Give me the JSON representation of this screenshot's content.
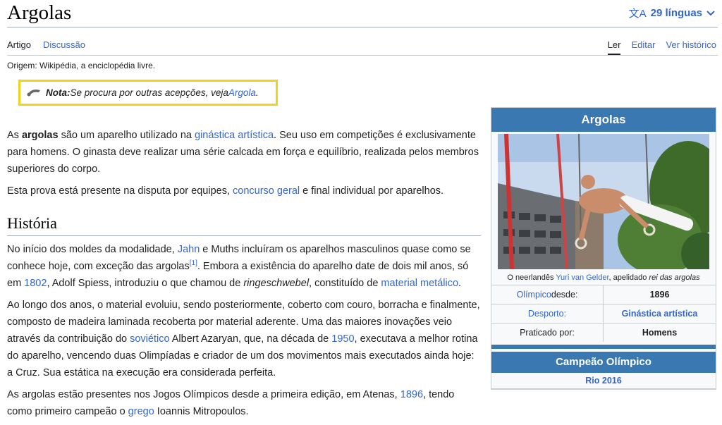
{
  "page": {
    "title": "Argolas",
    "languages": "29 línguas",
    "tabs_left": [
      "Artigo",
      "Discussão"
    ],
    "tabs_right": [
      "Ler",
      "Editar",
      "Ver histórico"
    ],
    "origin": "Origem: Wikipédia, a enciclopédia livre."
  },
  "note": {
    "label": "Nota:",
    "text": " Se procura por outras acepções, veja ",
    "link": "Argola",
    "end": "."
  },
  "intro": {
    "p1": {
      "a": "As ",
      "bold": "argolas",
      "b": " são um aparelho utilizado na ",
      "link1": "ginástica artística",
      "c": ". Seu uso em competições é exclusivamente para homens. O ginasta deve realizar uma série calcada em força e equilíbrio, realizada pelos membros superiores do corpo."
    },
    "p2": {
      "a": "Esta prova está presente na disputa por equipes, ",
      "link1": "concurso geral",
      "b": " e final individual por aparelhos."
    }
  },
  "history": {
    "heading": "História",
    "p1": {
      "a": "No início dos moldes da modalidade, ",
      "link1": "Jahn",
      "b": " e Muths incluíram os aparelhos masculinos quase como se conhece hoje, com exceção das argolas",
      "ref": "[1]",
      "c": ". Embora a existência do aparelho date de dois mil anos, só em ",
      "link2": "1802",
      "d": ", Adolf Spiess, introduziu o que chamou de ",
      "italic": "ringeschwebel",
      "e": ", constituído de ",
      "link3": "material metálico",
      "f": "."
    },
    "p2": {
      "a": "Ao longo dos anos, o material evoluiu, sendo posteriormente, coberto com couro, borracha e finalmente, composto de madeira laminada recoberta por material aderente. Uma das maiores inovações veio através da contribuição do ",
      "link1": "soviético",
      "b": " Albert Azaryan, que, na década de ",
      "link2": "1950",
      "c": ", executava a melhor rotina do aparelho, vencendo duas Olimpíadas e criador de um dos movimentos mais executados ainda hoje: a Cruz. Sua estática na execução era considerada perfeita."
    },
    "p3": {
      "a": "As argolas estão presentes nos Jogos Olímpicos desde a primeira edição, em Atenas, ",
      "link1": "1896",
      "b": ", tendo como primeiro campeão o ",
      "link2": "grego",
      "c": " Ioannis Mitropoulos."
    }
  },
  "infobox": {
    "title": "Argolas",
    "caption_a": "O neerlandês ",
    "caption_link": "Yuri van Gelder",
    "caption_b": ", apelidado ",
    "caption_italic": "rei das argolas",
    "rows": [
      {
        "label_link": "Olímpico",
        "label_rest": " desde:",
        "value": "1896",
        "value_link": false
      },
      {
        "label_link": "Desporto:",
        "label_rest": "",
        "value": "Ginástica artística",
        "value_link": true
      },
      {
        "label_link": "",
        "label_rest": "Praticado por:",
        "value": "Homens",
        "value_link": false
      }
    ],
    "champion_title": "Campeão Olímpico",
    "champion_edition": "Rio 2016"
  },
  "colors": {
    "link": "#3366cc",
    "infobox_header": "#3a78b2",
    "note_border": "#f0d31a"
  },
  "icons": [
    "translate-icon",
    "chevron-down-icon",
    "quote-icon"
  ]
}
